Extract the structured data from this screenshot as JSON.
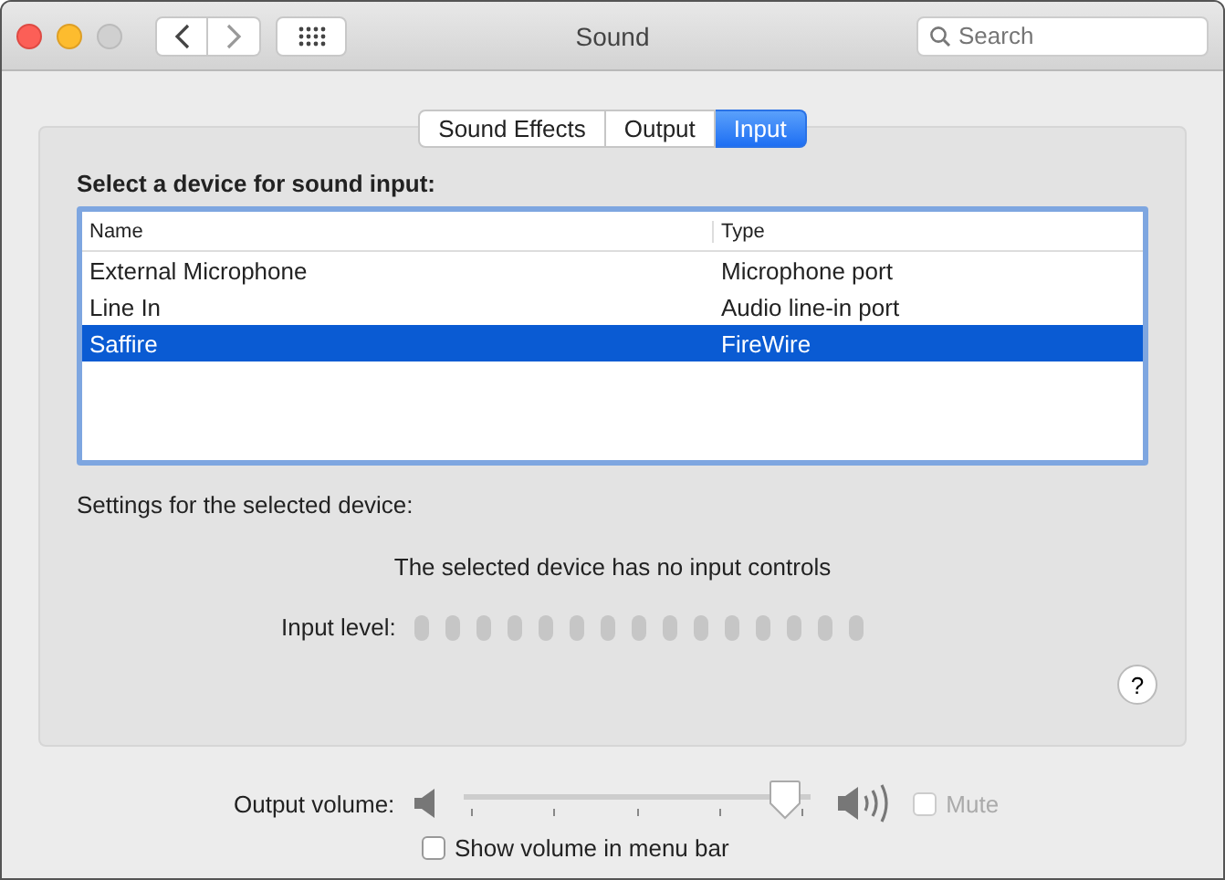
{
  "window": {
    "title": "Sound"
  },
  "search": {
    "placeholder": "Search"
  },
  "tabs": [
    {
      "label": "Sound Effects",
      "selected": false
    },
    {
      "label": "Output",
      "selected": false
    },
    {
      "label": "Input",
      "selected": true
    }
  ],
  "device_heading": "Select a device for sound input:",
  "table": {
    "columns": [
      "Name",
      "Type"
    ],
    "rows": [
      {
        "cells": [
          "External Microphone",
          "Microphone port"
        ],
        "selected": false
      },
      {
        "cells": [
          "Line In",
          "Audio line-in port"
        ],
        "selected": false
      },
      {
        "cells": [
          "Saffire",
          "FireWire"
        ],
        "selected": true
      }
    ]
  },
  "settings_label": "Settings for the selected device:",
  "no_controls_message": "The selected device has no input controls",
  "input_level": {
    "label": "Input level:"
  },
  "help": "?",
  "output_volume": {
    "label": "Output volume:",
    "level": 0.97
  },
  "mute": {
    "label": "Mute",
    "checked": false,
    "disabled": true
  },
  "show_volume": {
    "label": "Show volume in menu bar",
    "checked": false
  }
}
